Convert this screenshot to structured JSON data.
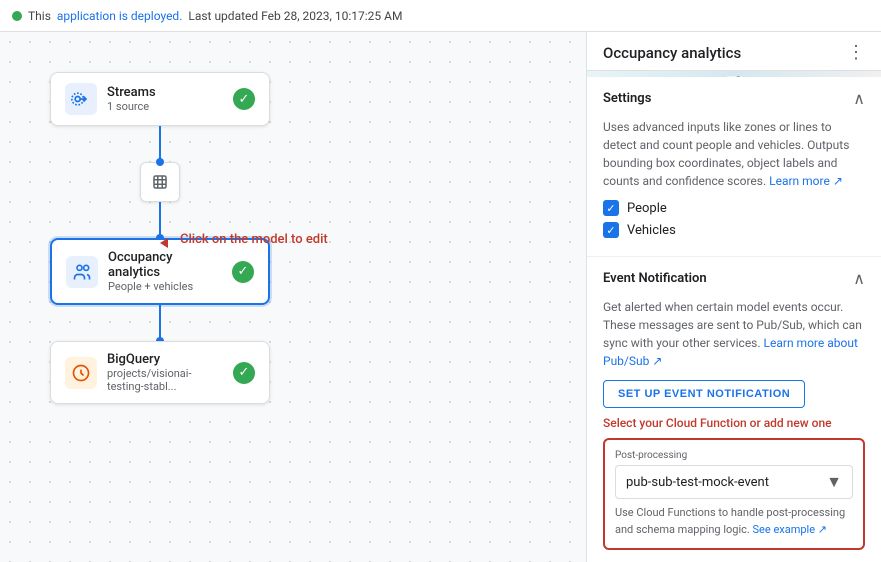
{
  "topbar": {
    "deployed_text": "This",
    "app_link": "application is deployed.",
    "last_updated": "Last updated Feb 28, 2023, 10:17:25 AM"
  },
  "pipeline": {
    "streams_node": {
      "title": "Streams",
      "subtitle": "1 source"
    },
    "occupancy_node": {
      "title": "Occupancy analytics",
      "subtitle": "People + vehicles"
    },
    "bigquery_node": {
      "title": "BigQuery",
      "subtitle": "projects/visionai-testing-stabl..."
    },
    "click_hint": "Click on the model to edit"
  },
  "right_panel": {
    "title": "Occupancy analytics",
    "settings_label": "Settings",
    "description": "Uses advanced inputs like zones or lines to detect and count people and vehicles. Outputs bounding box coordinates, object labels and counts and confidence scores.",
    "learn_more": "Learn more",
    "checkboxes": [
      {
        "label": "People",
        "checked": true
      },
      {
        "label": "Vehicles",
        "checked": true
      }
    ],
    "event_notification": {
      "title": "Event Notification",
      "description": "Get alerted when certain model events occur. These messages are sent to Pub/Sub, which can sync with your other services.",
      "learn_more_link": "Learn more about Pub/Sub",
      "setup_btn": "SET UP EVENT NOTIFICATION",
      "select_hint": "Select your Cloud Function or add new one",
      "post_processing_label": "Post-processing",
      "post_processing_value": "pub-sub-test-mock-event",
      "post_desc_1": "Use Cloud Functions to handle post-processing and schema mapping logic.",
      "see_example": "See example"
    }
  }
}
